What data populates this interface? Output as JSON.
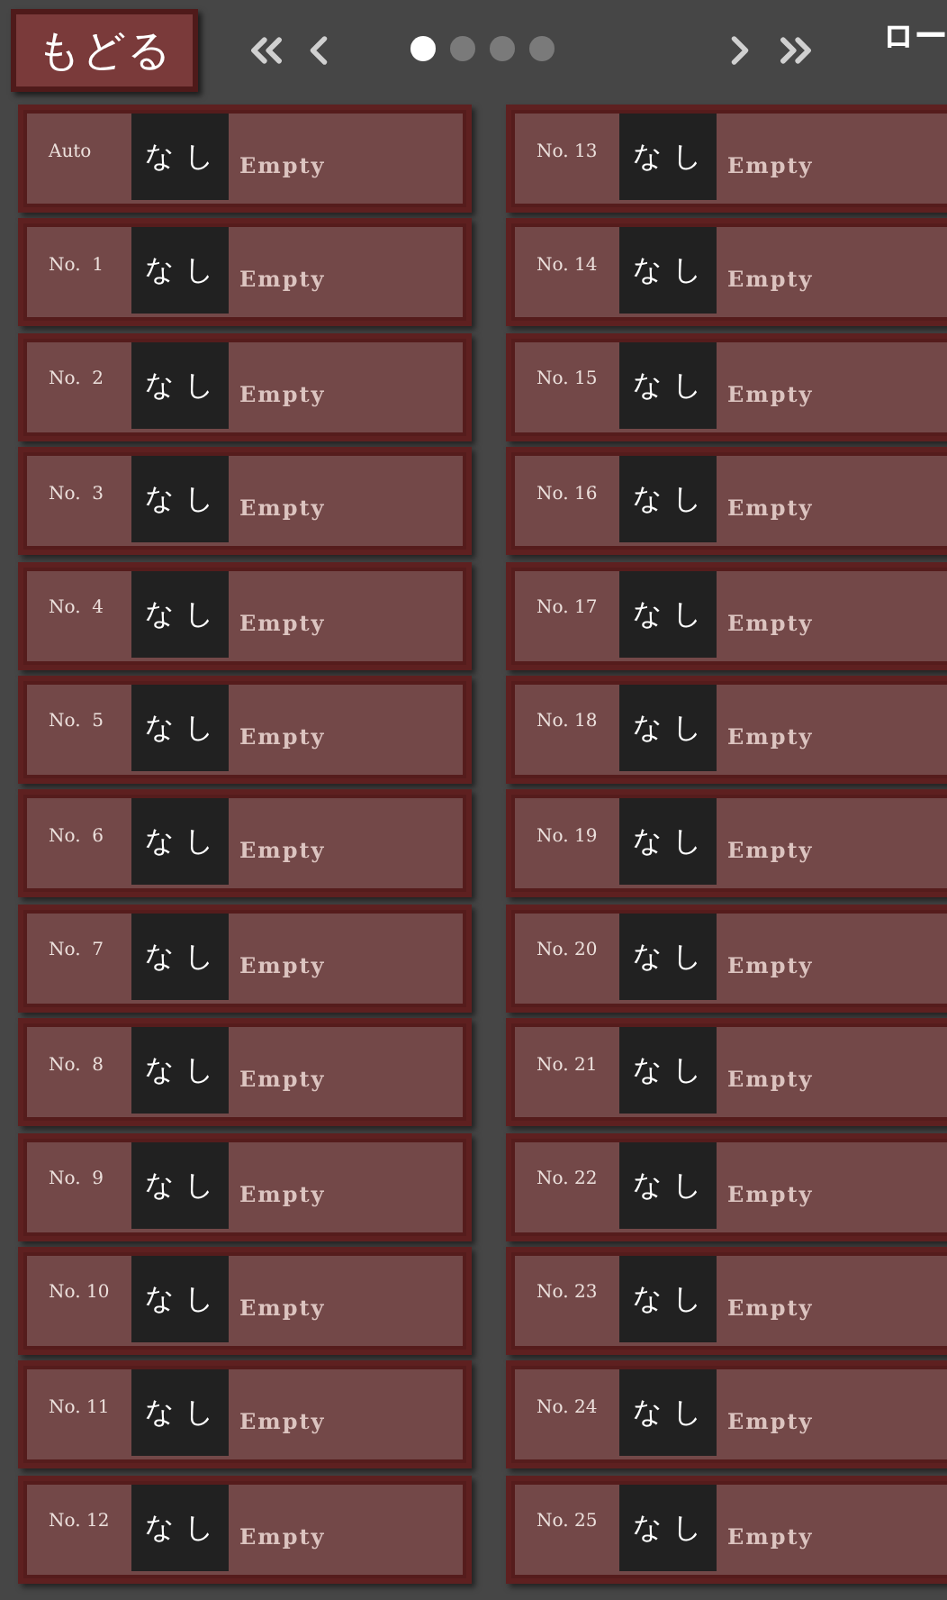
{
  "back_button": {
    "label": "もどる"
  },
  "pages": [
    {
      "selected": true
    },
    {
      "selected": false
    },
    {
      "selected": false
    },
    {
      "selected": false
    }
  ],
  "right_label": "ロー",
  "slots": [
    {
      "label": "Auto",
      "thumbnail": "なし",
      "status": "Empty"
    },
    {
      "label": "No.  1",
      "thumbnail": "なし",
      "status": "Empty"
    },
    {
      "label": "No.  2",
      "thumbnail": "なし",
      "status": "Empty"
    },
    {
      "label": "No.  3",
      "thumbnail": "なし",
      "status": "Empty"
    },
    {
      "label": "No.  4",
      "thumbnail": "なし",
      "status": "Empty"
    },
    {
      "label": "No.  5",
      "thumbnail": "なし",
      "status": "Empty"
    },
    {
      "label": "No.  6",
      "thumbnail": "なし",
      "status": "Empty"
    },
    {
      "label": "No.  7",
      "thumbnail": "なし",
      "status": "Empty"
    },
    {
      "label": "No.  8",
      "thumbnail": "なし",
      "status": "Empty"
    },
    {
      "label": "No.  9",
      "thumbnail": "なし",
      "status": "Empty"
    },
    {
      "label": "No. 10",
      "thumbnail": "なし",
      "status": "Empty"
    },
    {
      "label": "No. 11",
      "thumbnail": "なし",
      "status": "Empty"
    },
    {
      "label": "No. 12",
      "thumbnail": "なし",
      "status": "Empty"
    },
    {
      "label": "No. 13",
      "thumbnail": "なし",
      "status": "Empty"
    },
    {
      "label": "No. 14",
      "thumbnail": "なし",
      "status": "Empty"
    },
    {
      "label": "No. 15",
      "thumbnail": "なし",
      "status": "Empty"
    },
    {
      "label": "No. 16",
      "thumbnail": "なし",
      "status": "Empty"
    },
    {
      "label": "No. 17",
      "thumbnail": "なし",
      "status": "Empty"
    },
    {
      "label": "No. 18",
      "thumbnail": "なし",
      "status": "Empty"
    },
    {
      "label": "No. 19",
      "thumbnail": "なし",
      "status": "Empty"
    },
    {
      "label": "No. 20",
      "thumbnail": "なし",
      "status": "Empty"
    },
    {
      "label": "No. 21",
      "thumbnail": "なし",
      "status": "Empty"
    },
    {
      "label": "No. 22",
      "thumbnail": "なし",
      "status": "Empty"
    },
    {
      "label": "No. 23",
      "thumbnail": "なし",
      "status": "Empty"
    },
    {
      "label": "No. 24",
      "thumbnail": "なし",
      "status": "Empty"
    },
    {
      "label": "No. 25",
      "thumbnail": "なし",
      "status": "Empty"
    }
  ]
}
